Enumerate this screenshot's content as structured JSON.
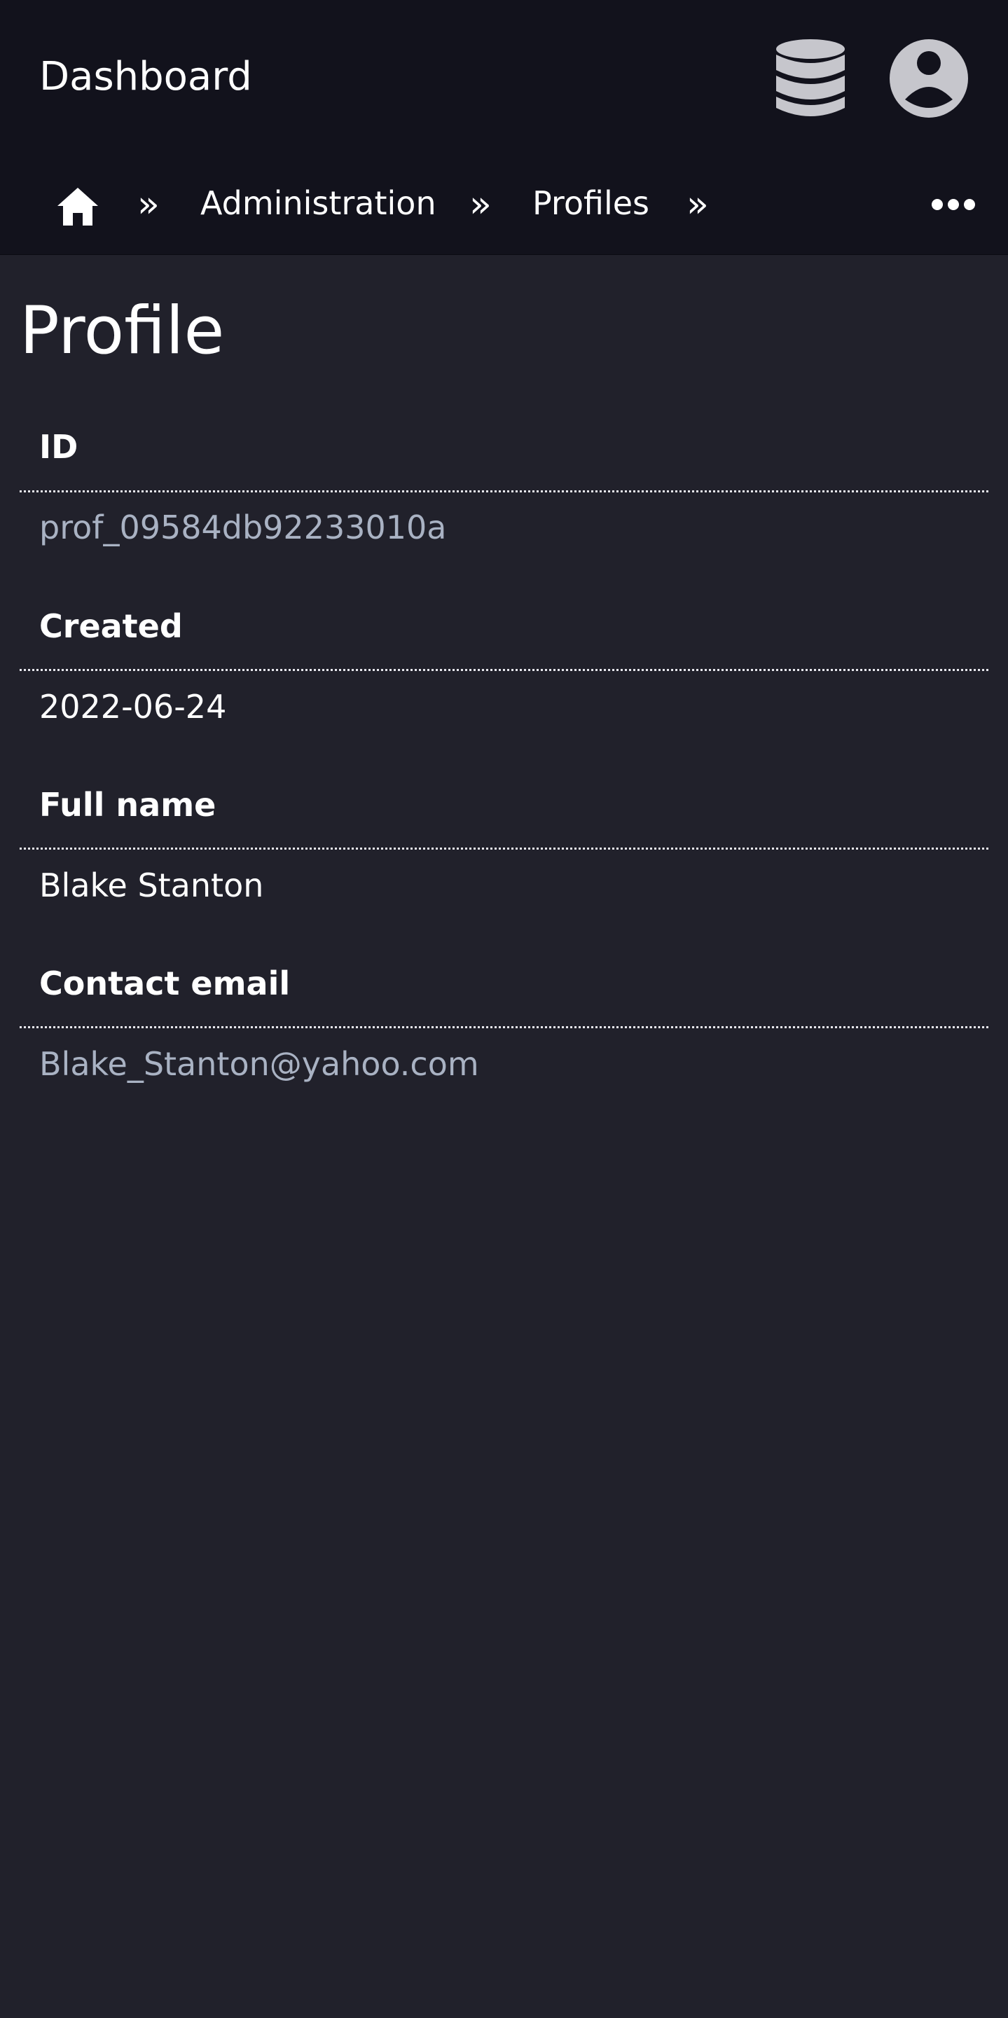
{
  "header": {
    "title": "Dashboard",
    "database_icon": "database-icon",
    "account_icon": "user-circle-icon"
  },
  "breadcrumb": {
    "home_icon": "home-icon",
    "separator": "»",
    "items": [
      {
        "label": "Administration"
      },
      {
        "label": "Profiles"
      }
    ],
    "more_icon": "ellipsis-icon"
  },
  "page": {
    "title": "Profile"
  },
  "fields": [
    {
      "label": "ID",
      "value": "prof_09584db92233010a"
    },
    {
      "label": "Created",
      "value": "2022-06-24"
    },
    {
      "label": "Full name",
      "value": "Blake Stanton"
    },
    {
      "label": "Contact email",
      "value": "Blake_Stanton@yahoo.com"
    }
  ],
  "colors": {
    "header_bg": "#12121c",
    "page_bg": "#21212b",
    "icon_gray": "#c6c6cc",
    "muted_value": "#a9b2c3"
  }
}
